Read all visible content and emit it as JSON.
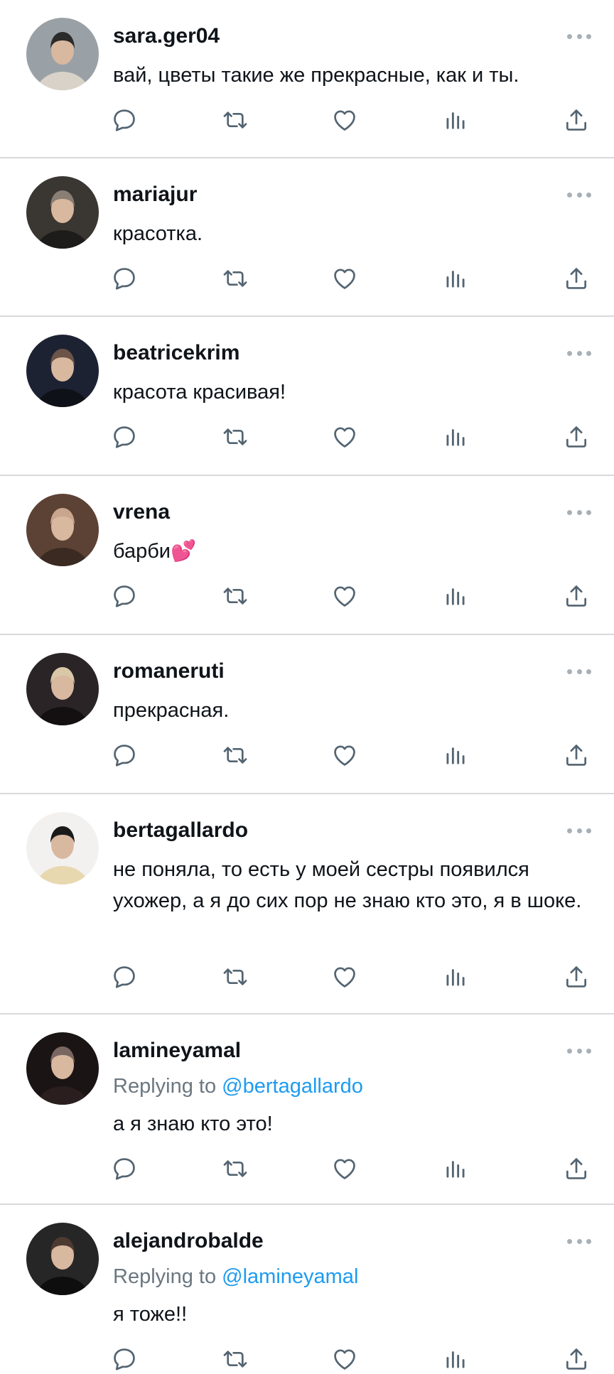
{
  "accent_color": "#1d9bf0",
  "action_icons": [
    "reply-icon",
    "retweet-icon",
    "like-icon",
    "views-icon",
    "share-icon"
  ],
  "replies": [
    {
      "username": "sara.ger04",
      "replying_label": "",
      "replying_to": "",
      "text": "вай, цветы такие же прекрасные, как и ты."
    },
    {
      "username": "mariajur",
      "replying_label": "",
      "replying_to": "",
      "text": "красотка."
    },
    {
      "username": "beatricekrim",
      "replying_label": "",
      "replying_to": "",
      "text": "красота красивая!"
    },
    {
      "username": "vrena",
      "replying_label": "",
      "replying_to": "",
      "text": "барби💕"
    },
    {
      "username": "romaneruti",
      "replying_label": "",
      "replying_to": "",
      "text": "прекрасная."
    },
    {
      "username": "bertagallardo",
      "replying_label": "",
      "replying_to": "",
      "text": "не поняла, то есть у моей сестры появился ухожер, а я до сих пор не знаю кто это, я в шоке."
    },
    {
      "username": "lamineyamal",
      "replying_label": "Replying to",
      "replying_to": "@bertagallardo",
      "text": "а я знаю кто это!"
    },
    {
      "username": "alejandrobalde",
      "replying_label": "Replying to",
      "replying_to": "@lamineyamal",
      "text": "я тоже!!"
    }
  ]
}
